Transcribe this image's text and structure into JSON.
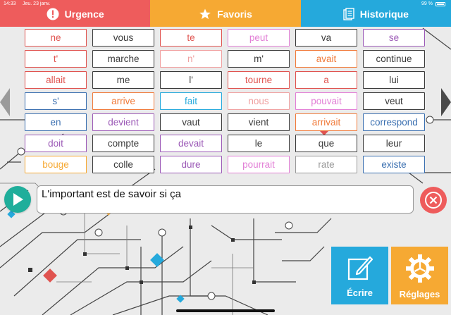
{
  "status": {
    "time": "14:33",
    "date": "Jeu. 23 janv.",
    "battery": "99 %"
  },
  "tabs": [
    {
      "label": "Urgence",
      "color": "#ee5c5c",
      "icon": "exclamation-circle-icon"
    },
    {
      "label": "Favoris",
      "color": "#f6a933",
      "icon": "star-icon"
    },
    {
      "label": "Historique",
      "color": "#25a9dc",
      "icon": "history-list-icon"
    }
  ],
  "words": [
    {
      "text": "ne",
      "color": "#e0534f"
    },
    {
      "text": "vous",
      "color": "#3a3a3a"
    },
    {
      "text": "te",
      "color": "#e0534f"
    },
    {
      "text": "peut",
      "color": "#e27fd6"
    },
    {
      "text": "va",
      "color": "#3a3a3a"
    },
    {
      "text": "se",
      "color": "#9b59b6"
    },
    {
      "text": "t'",
      "color": "#e0534f"
    },
    {
      "text": "marche",
      "color": "#3a3a3a"
    },
    {
      "text": "n'",
      "color": "#f0a0a0"
    },
    {
      "text": "m'",
      "color": "#3a3a3a"
    },
    {
      "text": "avait",
      "color": "#f07a3a"
    },
    {
      "text": "continue",
      "color": "#3a3a3a"
    },
    {
      "text": "allait",
      "color": "#e0534f"
    },
    {
      "text": "me",
      "color": "#3a3a3a"
    },
    {
      "text": "l'",
      "color": "#3a3a3a"
    },
    {
      "text": "tourne",
      "color": "#e0534f"
    },
    {
      "text": "a",
      "color": "#e0534f"
    },
    {
      "text": "lui",
      "color": "#3a3a3a"
    },
    {
      "text": "s'",
      "color": "#3a6fb0"
    },
    {
      "text": "arrive",
      "color": "#f07a3a"
    },
    {
      "text": "fait",
      "color": "#25a9dc"
    },
    {
      "text": "nous",
      "color": "#f0a0a0"
    },
    {
      "text": "pouvait",
      "color": "#e27fd6"
    },
    {
      "text": "veut",
      "color": "#3a3a3a"
    },
    {
      "text": "en",
      "color": "#3a6fb0"
    },
    {
      "text": "devient",
      "color": "#9b59b6"
    },
    {
      "text": "vaut",
      "color": "#3a3a3a"
    },
    {
      "text": "vient",
      "color": "#3a3a3a"
    },
    {
      "text": "arrivait",
      "color": "#f07a3a"
    },
    {
      "text": "correspond",
      "color": "#3a6fb0"
    },
    {
      "text": "doit",
      "color": "#9b59b6"
    },
    {
      "text": "compte",
      "color": "#3a3a3a"
    },
    {
      "text": "devait",
      "color": "#9b59b6"
    },
    {
      "text": "le",
      "color": "#3a3a3a"
    },
    {
      "text": "que",
      "color": "#3a3a3a"
    },
    {
      "text": "leur",
      "color": "#3a3a3a"
    },
    {
      "text": "bouge",
      "color": "#f6a933"
    },
    {
      "text": "colle",
      "color": "#3a3a3a"
    },
    {
      "text": "dure",
      "color": "#9b59b6"
    },
    {
      "text": "pourrait",
      "color": "#e27fd6"
    },
    {
      "text": "rate",
      "color": "#999999"
    },
    {
      "text": "existe",
      "color": "#3a6fb0"
    }
  ],
  "message": {
    "text": "L'important est de savoir si ça"
  },
  "actions": {
    "ecrire_label": "Écrire",
    "reglages_label": "Réglages"
  }
}
